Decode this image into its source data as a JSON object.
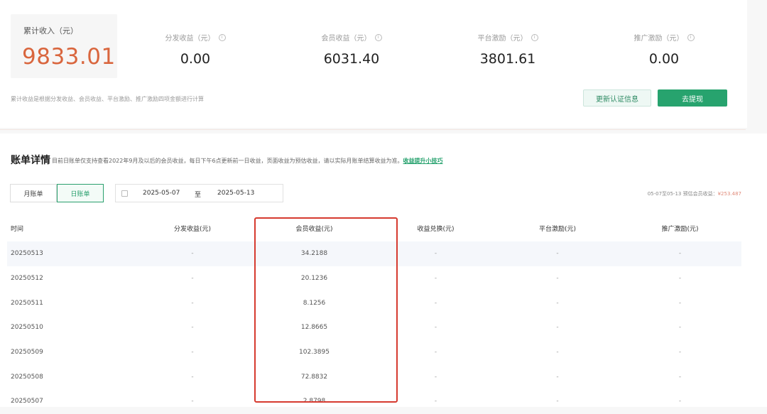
{
  "summary": {
    "total_label": "累计收入（元）",
    "total_value": "9833.01",
    "stats": [
      {
        "label": "分发收益（元）",
        "value": "0.00"
      },
      {
        "label": "会员收益（元）",
        "value": "6031.40"
      },
      {
        "label": "平台激励（元）",
        "value": "3801.61"
      },
      {
        "label": "推广激励（元）",
        "value": "0.00"
      }
    ],
    "note": "累计收益是根据分发收益、会员收益、平台激励、推广激励四项金额进行计算",
    "update_button": "更新认证信息",
    "withdraw_button": "去提现"
  },
  "bill": {
    "title": "账单详情",
    "desc": "目前日账单仅支持查看2022年9月及以后的会员收益，每日下午6点更新前一日收益，页面收益为预估收益，请以实际月账单结算收益为准。",
    "link": "收益提升小技巧",
    "tabs": [
      "月账单",
      "日账单"
    ],
    "active_tab": "日账单",
    "date_start": "2025-05-07",
    "date_sep": "至",
    "date_end": "2025-05-13",
    "estimate_prefix": "05-07至05-13 预估会员收益：",
    "estimate_amount": "¥253.487"
  },
  "table": {
    "columns": [
      "时间",
      "分发收益(元)",
      "会员收益(元)",
      "收益兑换(元)",
      "平台激励(元)",
      "推广激励(元)"
    ],
    "rows": [
      [
        "20250513",
        "-",
        "34.2188",
        "-",
        "-",
        "-"
      ],
      [
        "20250512",
        "-",
        "20.1236",
        "-",
        "-",
        "-"
      ],
      [
        "20250511",
        "-",
        "8.1256",
        "-",
        "-",
        "-"
      ],
      [
        "20250510",
        "-",
        "12.8665",
        "-",
        "-",
        "-"
      ],
      [
        "20250509",
        "-",
        "102.3895",
        "-",
        "-",
        "-"
      ],
      [
        "20250508",
        "-",
        "72.8832",
        "-",
        "-",
        "-"
      ],
      [
        "20250507",
        "-",
        "2.8798",
        "-",
        "-",
        "-"
      ]
    ]
  },
  "colors": {
    "accent": "#27a36e",
    "total": "#d9663e",
    "highlight": "#d63a2f"
  }
}
